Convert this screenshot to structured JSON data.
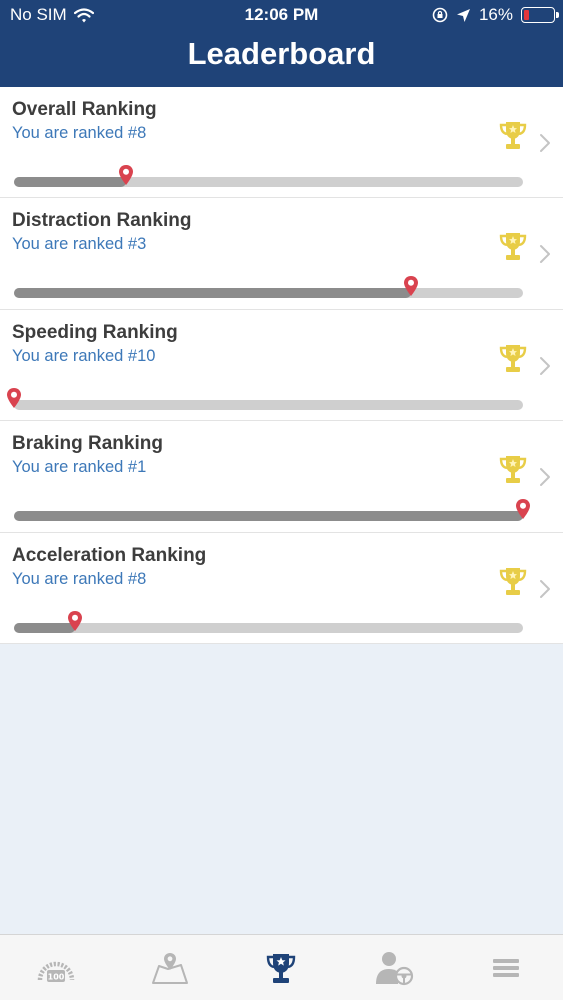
{
  "status_bar": {
    "carrier": "No SIM",
    "time": "12:06 PM",
    "battery": "16%",
    "battery_level": 0.16,
    "icons": [
      "wifi-icon",
      "orientation-lock-icon",
      "location-arrow-icon",
      "battery-icon"
    ]
  },
  "nav": {
    "title": "Leaderboard"
  },
  "rankings": [
    {
      "title": "Overall Ranking",
      "subtitle": "You are ranked #8",
      "progress": 0.22
    },
    {
      "title": "Distraction Ranking",
      "subtitle": "You are ranked #3",
      "progress": 0.78
    },
    {
      "title": "Speeding Ranking",
      "subtitle": "You are ranked #10",
      "progress": 0.0
    },
    {
      "title": "Braking Ranking",
      "subtitle": "You are ranked #1",
      "progress": 1.0
    },
    {
      "title": "Acceleration Ranking",
      "subtitle": "You are ranked #8",
      "progress": 0.12
    }
  ],
  "tab_bar": {
    "items": [
      {
        "icon": "dashboard-score-icon",
        "label": "100",
        "active": false
      },
      {
        "icon": "map-pin-icon",
        "active": false
      },
      {
        "icon": "trophy-icon",
        "active": true
      },
      {
        "icon": "driver-profile-icon",
        "active": false
      },
      {
        "icon": "menu-icon",
        "active": false
      }
    ]
  },
  "colors": {
    "nav_bar": "#1f4378",
    "subtitle": "#3d78b8",
    "trophy": "#e8cd47",
    "pin": "#d9434f",
    "background": "#eaf0f7",
    "tab_active": "#1f4378",
    "tab_inactive": "#b6b6b6"
  }
}
